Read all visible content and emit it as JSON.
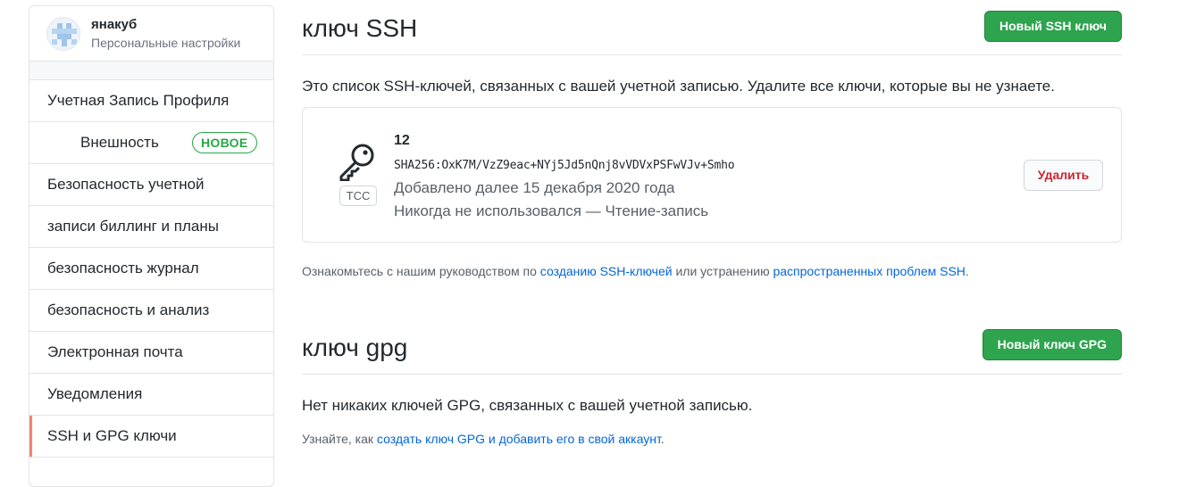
{
  "sidebar": {
    "user_name": "янакуб",
    "user_subtitle": "Персональные настройки",
    "items": [
      {
        "label": "Учетная Запись Профиля"
      },
      {
        "label": "Внешность",
        "badge": "НОВОЕ"
      },
      {
        "label": "Безопасность учетной"
      },
      {
        "label": "записи биллинг и планы"
      },
      {
        "label": "безопасность журнал"
      },
      {
        "label": "безопасность и анализ"
      },
      {
        "label": "Электронная почта"
      },
      {
        "label": "Уведомления"
      },
      {
        "label": "SSH и GPG ключи"
      }
    ]
  },
  "ssh": {
    "title": "ключ SSH",
    "new_button": "Новый SSH ключ",
    "description": "Это список SSH-ключей, связанных с вашей учетной записью. Удалите все ключи, которые вы не узнаете.",
    "key": {
      "icon": "key-icon",
      "name": "12",
      "badge": "ТСС",
      "fingerprint": "SHA256:OxK7M/VzZ9eac+NYj5Jd5nQnj8vVDVxPSFwVJv+Smho",
      "added": "Добавлено далее 15 декабря 2020 года",
      "usage": "Никогда не использовался — Чтение-запись",
      "delete_button": "Удалить"
    },
    "guide": {
      "prefix": "Ознакомьтесь с нашим руководством по ",
      "link1": "созданию SSH-ключей",
      "middle": " или устранению ",
      "link2": "распространенных проблем SSH",
      "suffix": "."
    }
  },
  "gpg": {
    "title": "ключ gpg",
    "new_button": "Новый ключ GPG",
    "description": "Нет никаких ключей GPG, связанных с вашей учетной записью.",
    "guide": {
      "prefix": "Узнайте, как ",
      "link": "создать ключ GPG и добавить его в свой аккаунт",
      "suffix": "."
    }
  },
  "colors": {
    "primary_button": "#2ea44f",
    "link": "#0366d6",
    "danger": "#cb2431",
    "selected_marker": "#f9826c",
    "new_badge": "#28a745"
  }
}
